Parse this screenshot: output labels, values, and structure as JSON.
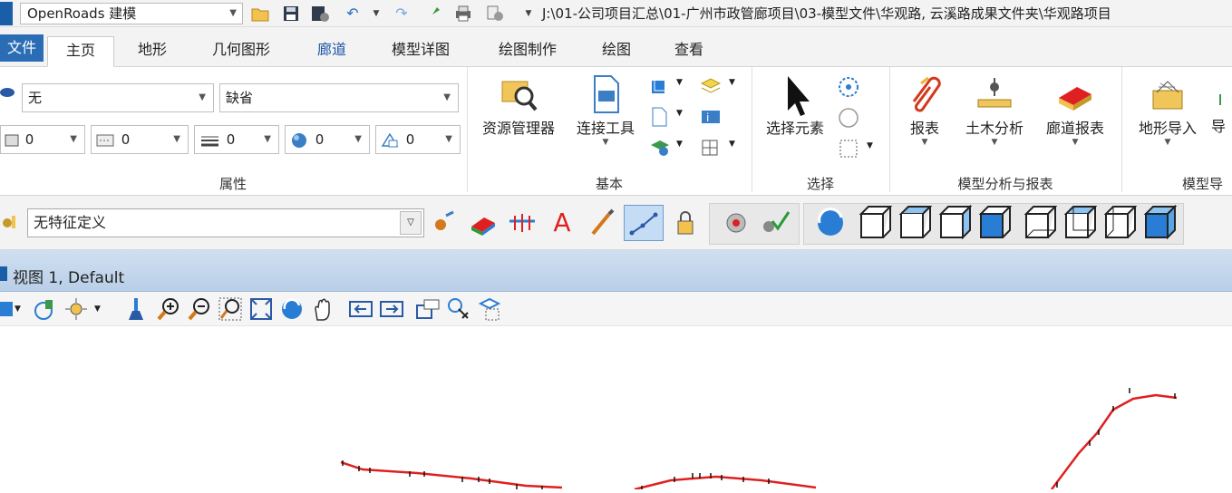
{
  "titlebar": {
    "workspace": "OpenRoads 建模",
    "path": "J:\\01-公司项目汇总\\01-广州市政管廊项目\\03-模型文件\\华观路, 云溪路成果文件夹\\华观路项目"
  },
  "tabs": [
    {
      "label": "文件",
      "state": "file"
    },
    {
      "label": "主页",
      "state": "active"
    },
    {
      "label": "地形",
      "state": "normal"
    },
    {
      "label": "几何图形",
      "state": "normal"
    },
    {
      "label": "廊道",
      "state": "highlight"
    },
    {
      "label": "模型详图",
      "state": "normal"
    },
    {
      "label": "绘图制作",
      "state": "normal"
    },
    {
      "label": "绘图",
      "state": "normal"
    },
    {
      "label": "查看",
      "state": "normal"
    }
  ],
  "attributes": {
    "level": "无",
    "style": "缺省",
    "weight_values": [
      "0",
      "0",
      "0",
      "0",
      "0"
    ],
    "group_label": "属性"
  },
  "basic": {
    "resource_manager": "资源管理器",
    "connect_tools": "连接工具",
    "group_label": "基本"
  },
  "select": {
    "select_element": "选择元素",
    "group_label": "选择"
  },
  "analysis": {
    "report": "报表",
    "civil_analysis": "土木分析",
    "corridor_report": "廊道报表",
    "group_label": "模型分析与报表"
  },
  "import": {
    "terrain_import": "地形导入",
    "partial": "导",
    "group_label": "模型导"
  },
  "feature": {
    "definition": "无特征定义"
  },
  "view": {
    "title": "视图 1, Default"
  },
  "colors": {
    "accent": "#2b6db5",
    "tab_blue": "#1a56a5",
    "alignment_red": "#e02020"
  }
}
